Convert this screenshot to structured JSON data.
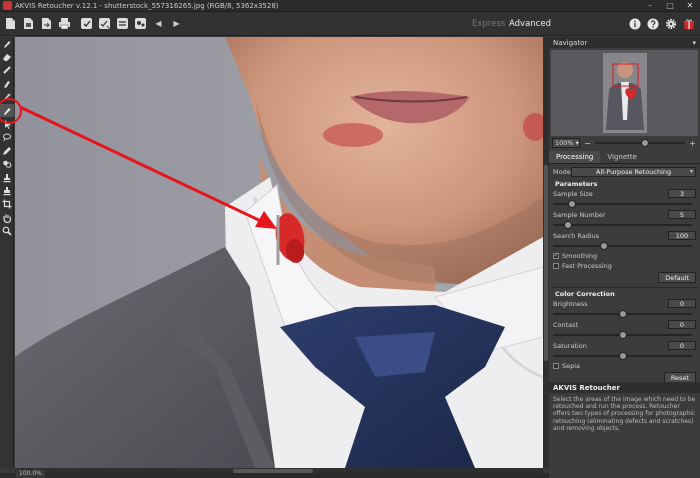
{
  "window": {
    "title": "AKVIS Retoucher v.12.1 - shutterstock_557316265.jpg (RGB/8, 5362x3528)",
    "minimize": "–",
    "maximize": "□",
    "close": "✕"
  },
  "toolbar": {
    "modes": {
      "express": "Express",
      "advanced": "Advanced"
    },
    "undo": "◀",
    "redo": "▶"
  },
  "navigator": {
    "title": "Navigator",
    "zoom": "100%",
    "zoom_out": "−",
    "zoom_in": "+",
    "zoom_slider_position": 0.55
  },
  "tabs": {
    "processing": "Processing",
    "vignette": "Vignette"
  },
  "processing": {
    "mode_label": "Mode:",
    "mode_value": "All-Purpose Retouching",
    "parameters_title": "Parameters",
    "sample_size": {
      "label": "Sample Size",
      "value": "3",
      "position": 0.14
    },
    "sample_number": {
      "label": "Sample Number",
      "value": "5",
      "position": 0.11
    },
    "search_radius": {
      "label": "Search Radius",
      "value": "100",
      "position": 0.37
    },
    "smoothing": {
      "label": "Smoothing",
      "checked": true,
      "mark": "✓"
    },
    "fast_processing": {
      "label": "Fast Processing",
      "checked": false
    },
    "default_button": "Default",
    "color_title": "Color Correction",
    "brightness": {
      "label": "Brightness",
      "value": "0",
      "position": 0.5
    },
    "contrast": {
      "label": "Contast",
      "value": "0",
      "position": 0.5
    },
    "saturation": {
      "label": "Saturation",
      "value": "0",
      "position": 0.5
    },
    "sepia": {
      "label": "Sepia",
      "checked": false
    },
    "reset_button": "Reset"
  },
  "info": {
    "title": "AKVIS Retoucher",
    "text": "Select the areas of the image which need to be retouched and run the process. Retoucher offers two types of processing for photographic retouching (eliminating defects and scratches) and removing objects."
  },
  "status": {
    "zoom": "100.0%"
  },
  "colors": {
    "annotation": "#e8141c",
    "panel": "#3c3c3c",
    "lipstick": "#d62a2a"
  }
}
